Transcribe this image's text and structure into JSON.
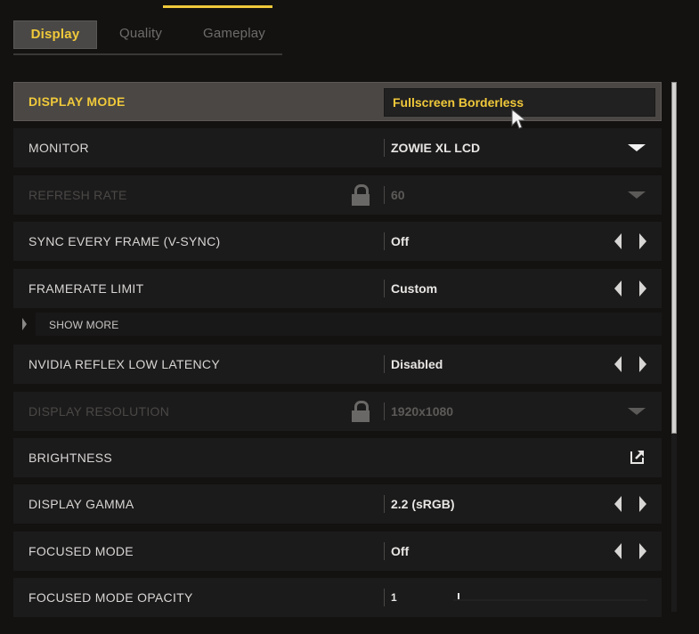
{
  "tabs": [
    {
      "label": "Display",
      "active": true
    },
    {
      "label": "Quality",
      "active": false
    },
    {
      "label": "Gameplay",
      "active": false
    }
  ],
  "colors": {
    "accent": "#f0c93a",
    "background": "#141211",
    "row_bg": "#1c1b1b",
    "selected_row_bg": "#4a4745",
    "disabled_text": "#4a4846"
  },
  "settings": {
    "display_mode": {
      "label": "DISPLAY MODE",
      "value": "Fullscreen Borderless",
      "control": "dropdown",
      "selected": true
    },
    "monitor": {
      "label": "MONITOR",
      "value": "ZOWIE XL LCD",
      "control": "dropdown"
    },
    "refresh_rate": {
      "label": "REFRESH RATE",
      "value": "60",
      "control": "dropdown",
      "locked": true
    },
    "vsync": {
      "label": "SYNC EVERY FRAME (V-SYNC)",
      "value": "Off",
      "control": "stepper"
    },
    "framerate_limit": {
      "label": "FRAMERATE LIMIT",
      "value": "Custom",
      "control": "stepper"
    },
    "show_more": {
      "label": "SHOW MORE"
    },
    "nvidia_reflex": {
      "label": "NVIDIA REFLEX LOW LATENCY",
      "value": "Disabled",
      "control": "stepper"
    },
    "display_resolution": {
      "label": "DISPLAY RESOLUTION",
      "value": "1920x1080",
      "control": "dropdown",
      "locked": true
    },
    "brightness": {
      "label": "BRIGHTNESS",
      "control": "external-link"
    },
    "display_gamma": {
      "label": "DISPLAY GAMMA",
      "value": "2.2 (sRGB)",
      "control": "stepper"
    },
    "focused_mode": {
      "label": "FOCUSED MODE",
      "value": "Off",
      "control": "stepper"
    },
    "focused_mode_opacity": {
      "label": "FOCUSED MODE OPACITY",
      "value": "1",
      "control": "slider",
      "slider_fraction": 0.07
    }
  },
  "icons": {
    "dropdown": "caret-down-icon",
    "stepper_left": "arrow-left-icon",
    "stepper_right": "arrow-right-icon",
    "lock": "lock-icon",
    "external": "external-link-icon",
    "expand": "expand-arrow-icon"
  },
  "scrollbar": {
    "visible_fraction": 0.66,
    "position_fraction": 0.0
  }
}
